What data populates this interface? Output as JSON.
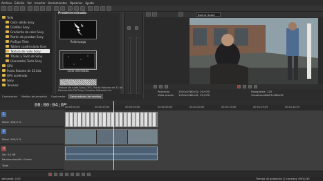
{
  "menu": [
    "Archivo",
    "Edición",
    "Ver",
    "Insertar",
    "Herramientas",
    "Opciones",
    "Ayuda"
  ],
  "tree": [
    {
      "label": "Todo",
      "indent": 1
    },
    {
      "label": "Color sólido Sony",
      "indent": 2
    },
    {
      "label": "Créditos Sony",
      "indent": 2
    },
    {
      "label": "Gradiente de color Sony",
      "indent": 2
    },
    {
      "label": "Patrón de pruebas Sony",
      "indent": 2
    },
    {
      "label": "ProType Titler",
      "indent": 2
    },
    {
      "label": "Tablero cuadriculado Sony",
      "indent": 2
    },
    {
      "label": "Textura de ruido Sony",
      "indent": 2,
      "selected": true
    },
    {
      "label": "Títulos y Texto de Sony",
      "indent": 2
    },
    {
      "label": "(Heredado) Texto Sony",
      "indent": 2
    },
    {
      "label": "GPU",
      "indent": 1
    },
    {
      "label": "Punto flotante de 32 bits",
      "indent": 1
    },
    {
      "label": "GPU acelerado",
      "indent": 1
    },
    {
      "label": "Sony",
      "indent": 1
    },
    {
      "label": "Terceros",
      "indent": 1
    }
  ],
  "preset_title": "Predeterminado",
  "presets": [
    "Relámpago",
    "Cielo estrellado"
  ],
  "preset_info": [
    "Textura de ruido Sony: OFX, Punto flotante de 32 bit",
    "Descripción De Sony Creative Software Inc."
  ],
  "tabs": [
    "Conexiones",
    "Medios de proyecto",
    "Explorador",
    "Generadores de medios"
  ],
  "active_tab": "Generadores de medios",
  "preview": {
    "quality": "Buena (total)",
    "project_label": "Proyecto:",
    "project_value": "1920x1080x32; 29,970i",
    "preview_label": "Vista previa:",
    "preview_value": "1920x1080x32; 29,970i",
    "frame_label": "Fotograma:",
    "frame_value": "120",
    "display_label": "Visualización:",
    "display_value": "473x266x32"
  },
  "timecode": "00:00:04;08",
  "ruler": [
    "00:00:00;00",
    "00:00:15;00",
    "00:00:30;00",
    "00:00:45;00",
    "00:01:00;00",
    "00:01:15;00",
    "00:01:29;29",
    "00:01:44;29"
  ],
  "tracks": [
    {
      "num": "1",
      "level": "Nivel: 100,0 %"
    },
    {
      "num": "2",
      "level": "Nivel: 100,0 %"
    },
    {
      "num": "3",
      "vol": "Vol: 0,0 dB",
      "pan": "Panoramización: Centro",
      "touch": "Táctil"
    }
  ],
  "statusbar": {
    "speed": "Velocidad: 0,00",
    "record": "Tiempo de grabación (2 canales): 89:52:40"
  },
  "colors": {
    "accent": "#4a6fa5",
    "folder": "#d9b54a",
    "selected": "#e8e8e8"
  }
}
